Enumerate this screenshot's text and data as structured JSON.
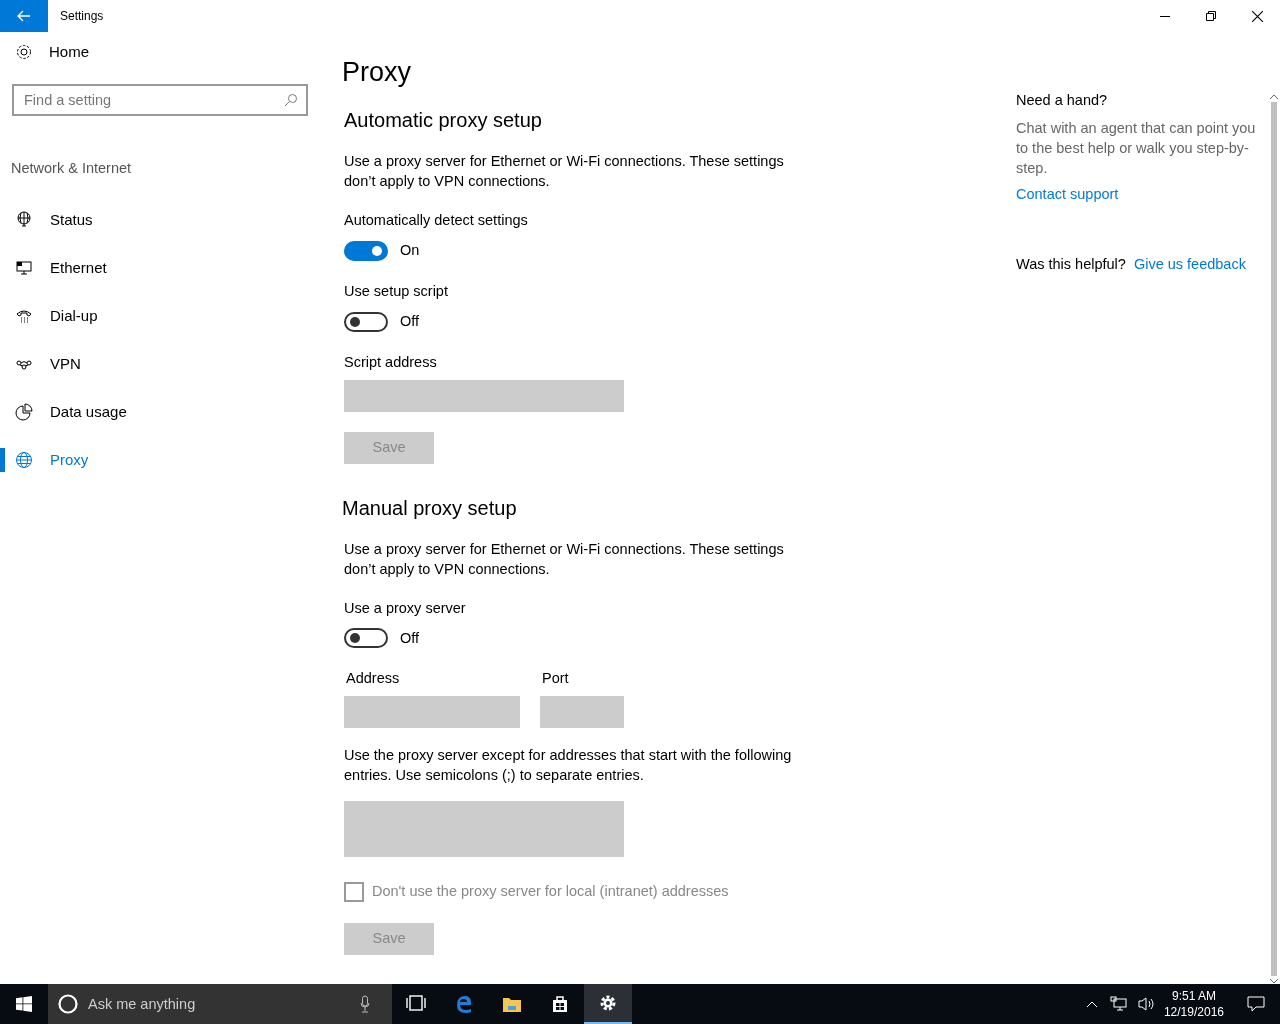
{
  "window": {
    "title": "Settings"
  },
  "sidebar": {
    "home": "Home",
    "search": {
      "placeholder": "Find a setting"
    },
    "section": "Network & Internet",
    "items": [
      {
        "label": "Status",
        "kind": "status",
        "selected": false
      },
      {
        "label": "Ethernet",
        "kind": "ethernet",
        "selected": false
      },
      {
        "label": "Dial-up",
        "kind": "dialup",
        "selected": false
      },
      {
        "label": "VPN",
        "kind": "vpn",
        "selected": false
      },
      {
        "label": "Data usage",
        "kind": "data",
        "selected": false
      },
      {
        "label": "Proxy",
        "kind": "proxy",
        "selected": true
      }
    ]
  },
  "page": {
    "title": "Proxy",
    "blocks": [
      {
        "kind": "heading",
        "text": "Automatic proxy setup"
      },
      {
        "kind": "paragraph",
        "text": "Use a proxy server for Ethernet or Wi-Fi connections. These settings don’t apply to VPN connections."
      },
      {
        "kind": "toggle",
        "label": "Automatically detect settings",
        "on": true,
        "state_text": "On"
      },
      {
        "kind": "toggle",
        "label": "Use setup script",
        "on": false,
        "state_text": "Off"
      },
      {
        "kind": "field",
        "label": "Script address",
        "disabled": true
      },
      {
        "kind": "button",
        "label": "Save",
        "disabled": true
      },
      {
        "kind": "heading",
        "text": "Manual proxy setup"
      },
      {
        "kind": "paragraph",
        "text": "Use a proxy server for Ethernet or Wi-Fi connections. These settings don’t apply to VPN connections."
      },
      {
        "kind": "toggle",
        "label": "Use a proxy server",
        "on": false,
        "state_text": "Off"
      },
      {
        "kind": "field_pair",
        "label": "Address",
        "second_label": "Port",
        "disabled": true
      },
      {
        "kind": "paragraph",
        "text": "Use the proxy server except for addresses that start with the following entries. Use semicolons (;) to separate entries."
      },
      {
        "kind": "textarea",
        "disabled": true
      },
      {
        "kind": "checkbox",
        "label": "Don't use the proxy server for local (intranet) addresses",
        "checked": false,
        "disabled": true
      },
      {
        "kind": "button",
        "label": "Save",
        "disabled": true
      }
    ]
  },
  "help": {
    "title": "Need a hand?",
    "text": "Chat with an agent that can point you to the best help or walk you step-by-step.",
    "link": "Contact support",
    "feedback_question": "Was this helpful?",
    "feedback_link": "Give us feedback"
  },
  "taskbar": {
    "search_placeholder": "Ask me anything",
    "apps": [
      {
        "kind": "taskview",
        "selected": false
      },
      {
        "kind": "browser",
        "selected": false
      },
      {
        "kind": "folder",
        "selected": false
      },
      {
        "kind": "store",
        "selected": false
      },
      {
        "kind": "settings",
        "selected": true
      }
    ],
    "time": "9:51 AM",
    "date": "12/19/2016"
  }
}
